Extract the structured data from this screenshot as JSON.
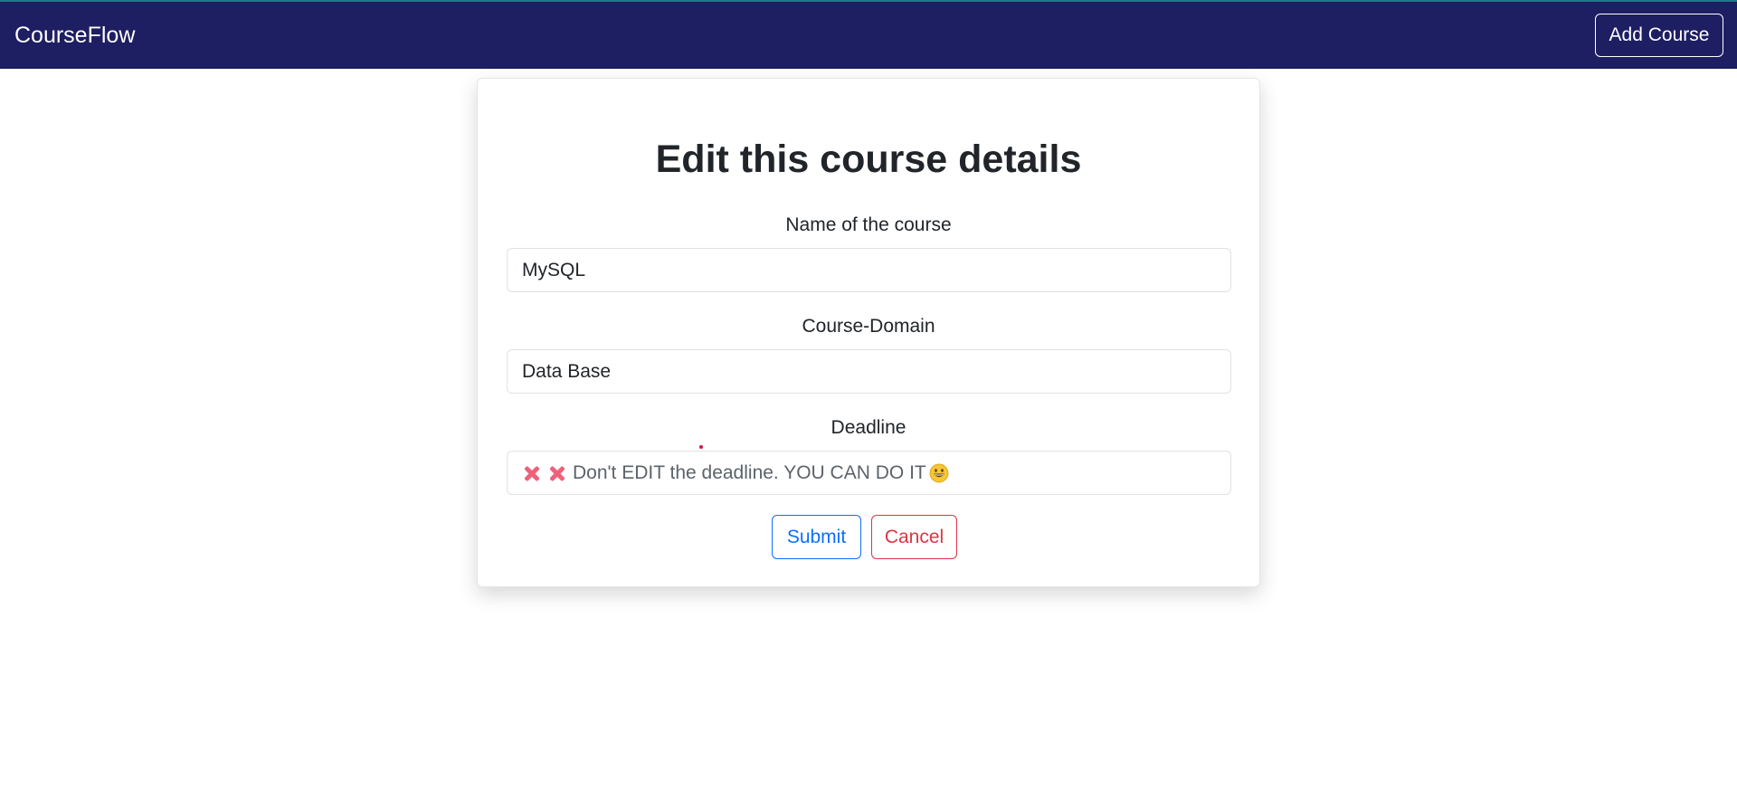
{
  "navbar": {
    "brand": "CourseFlow",
    "add_course_label": "Add Course"
  },
  "form": {
    "title": "Edit this course details",
    "name_label": "Name of the course",
    "name_value": "MySQL",
    "domain_label": "Course-Domain",
    "domain_value": "Data Base",
    "deadline_label": "Deadline",
    "deadline_placeholder": "Don't EDIT the deadline. YOU CAN DO IT",
    "submit_label": "Submit",
    "cancel_label": "Cancel"
  },
  "colors": {
    "navbar_bg": "#1e1e62",
    "submit": "#0d6efd",
    "cancel": "#dc3545",
    "x_icon": "#f0607a"
  },
  "icons": {
    "deadline_prefix": [
      "cross-mark-icon",
      "cross-mark-icon"
    ],
    "deadline_suffix": "grinning-face-icon"
  }
}
